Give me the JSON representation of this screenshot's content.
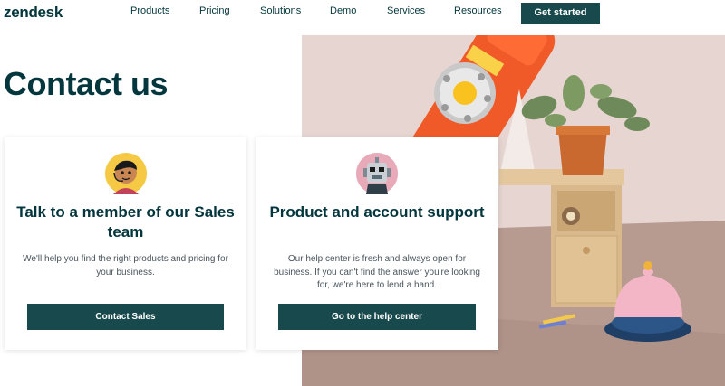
{
  "brand": {
    "logo": "zendesk"
  },
  "nav": {
    "items": [
      {
        "label": "Products"
      },
      {
        "label": "Pricing"
      },
      {
        "label": "Solutions"
      },
      {
        "label": "Demo"
      },
      {
        "label": "Services"
      },
      {
        "label": "Resources"
      }
    ],
    "cta_label": "Get started"
  },
  "hero": {
    "title": "Contact us"
  },
  "cards": [
    {
      "title": "Talk to a member of our Sales team",
      "description": "We'll help you find the right products and pricing for your business.",
      "button": "Contact Sales",
      "avatar_icon": "salesperson-avatar-icon"
    },
    {
      "title": "Product and account support",
      "description": "Our help center is fresh and always open for business. If you can't find the answer you're looking for, we're here to lend a hand.",
      "button": "Go to the help center",
      "avatar_icon": "robot-avatar-icon"
    }
  ],
  "colors": {
    "brand_dark": "#03363d",
    "button_bg": "#17494d",
    "phone_orange": "#f05a28",
    "background_photo": "#e6d5d0"
  }
}
